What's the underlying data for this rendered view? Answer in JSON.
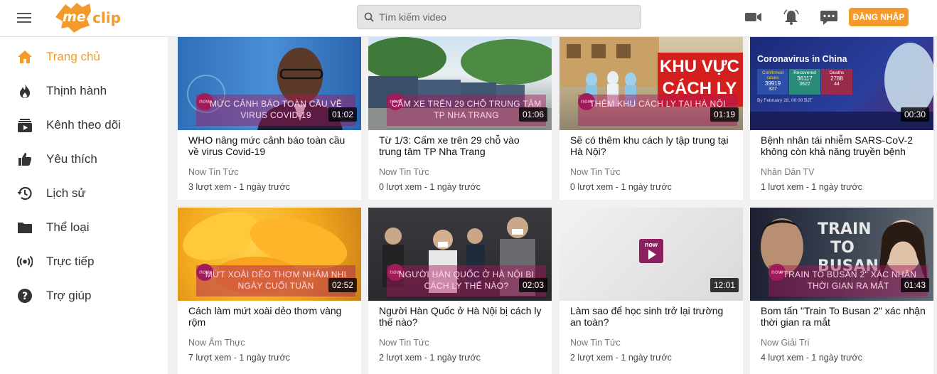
{
  "header": {
    "logo_text": "meclip",
    "search_placeholder": "Tìm kiếm video",
    "login_label": "ĐĂNG NHẬP"
  },
  "sidebar": {
    "items": [
      {
        "label": "Trang chủ",
        "icon": "home-icon",
        "active": true
      },
      {
        "label": "Thịnh hành",
        "icon": "fire-icon"
      },
      {
        "label": "Kênh theo dõi",
        "icon": "subscriptions-icon"
      },
      {
        "label": "Yêu thích",
        "icon": "thumbs-up-icon"
      },
      {
        "label": "Lịch sử",
        "icon": "history-icon"
      },
      {
        "label": "Thể loại",
        "icon": "folder-icon"
      },
      {
        "label": "Trực tiếp",
        "icon": "live-icon"
      },
      {
        "label": "Trợ giúp",
        "icon": "help-icon"
      }
    ]
  },
  "colors": {
    "accent": "#f39a2c",
    "now_brand": "#9a1f5a"
  },
  "videos": [
    {
      "title": "WHO nâng mức cảnh báo toàn cầu về virus Covid-19",
      "channel": "Now Tin Tức",
      "meta": "3 lượt xem - 1 ngày trước",
      "duration": "01:02",
      "caption": "MỨC CẢNH BÁO TOÀN CẦU VỀ VIRUS COVID-19"
    },
    {
      "title": "Từ 1/3: Cấm xe trên 29 chỗ vào trung tâm TP Nha Trang",
      "channel": "Now Tin Tức",
      "meta": "0 lượt xem - 1 ngày trước",
      "duration": "01:06",
      "caption": "CẤM XE TRÊN 29 CHỖ TRUNG TÂM TP NHA TRANG"
    },
    {
      "title": "Sẽ có thêm khu cách ly tập trung tại Hà Nội?",
      "channel": "Now Tin Tức",
      "meta": "0 lượt xem - 1 ngày trước",
      "duration": "01:19",
      "caption": "THÊM KHU CÁCH LY TẠI HÀ NỘI",
      "sign": "KHU VỰC CÁCH LY"
    },
    {
      "title": "Bệnh nhân tái nhiễm SARS-CoV-2 không còn khả năng truyền bệnh",
      "channel": "Nhân Dân TV",
      "meta": "1 lượt xem - 1 ngày trước",
      "duration": "00:30",
      "headline": "Coronavirus in China",
      "stats_labels": [
        "Confirmed cases",
        "Recovered",
        "Deaths"
      ],
      "stats_values": [
        "39919",
        "36117",
        "2788"
      ],
      "stats_deltas": [
        "327",
        "3622",
        "44"
      ],
      "dateline": "By February 28, 00:00 BJT"
    },
    {
      "title": "Cách làm mứt xoài dẻo thơm vàng rộm",
      "channel": "Now Ẩm Thực",
      "meta": "7 lượt xem - 1 ngày trước",
      "duration": "02:52",
      "caption": "MỨT XOÀI DẺO THƠM NHÂM NHI NGÀY CUỐI TUẦN"
    },
    {
      "title": "Người Hàn Quốc ở Hà Nội bị cách ly thế nào?",
      "channel": "Now Tin Tức",
      "meta": "2 lượt xem - 1 ngày trước",
      "duration": "02:03",
      "caption": "NGƯỜI HÀN QUỐC Ở HÀ NỘI BỊ CÁCH LY THẾ NÀO?"
    },
    {
      "title": "Làm sao để học sinh trở lại trường an toàn?",
      "channel": "Now Tin Tức",
      "meta": "2 lượt xem - 1 ngày trước",
      "duration": "12:01",
      "badge": "now"
    },
    {
      "title": "Bom tấn \"Train To Busan 2\" xác nhận thời gian ra mắt",
      "channel": "Now Giải Trí",
      "meta": "4 lượt xem - 1 ngày trước",
      "duration": "01:43",
      "caption": "\"TRAIN TO BUSAN 2\" XÁC NHẬN THỜI GIAN RA MẮT",
      "poster_title": "TRAIN TO BUSAN"
    }
  ]
}
